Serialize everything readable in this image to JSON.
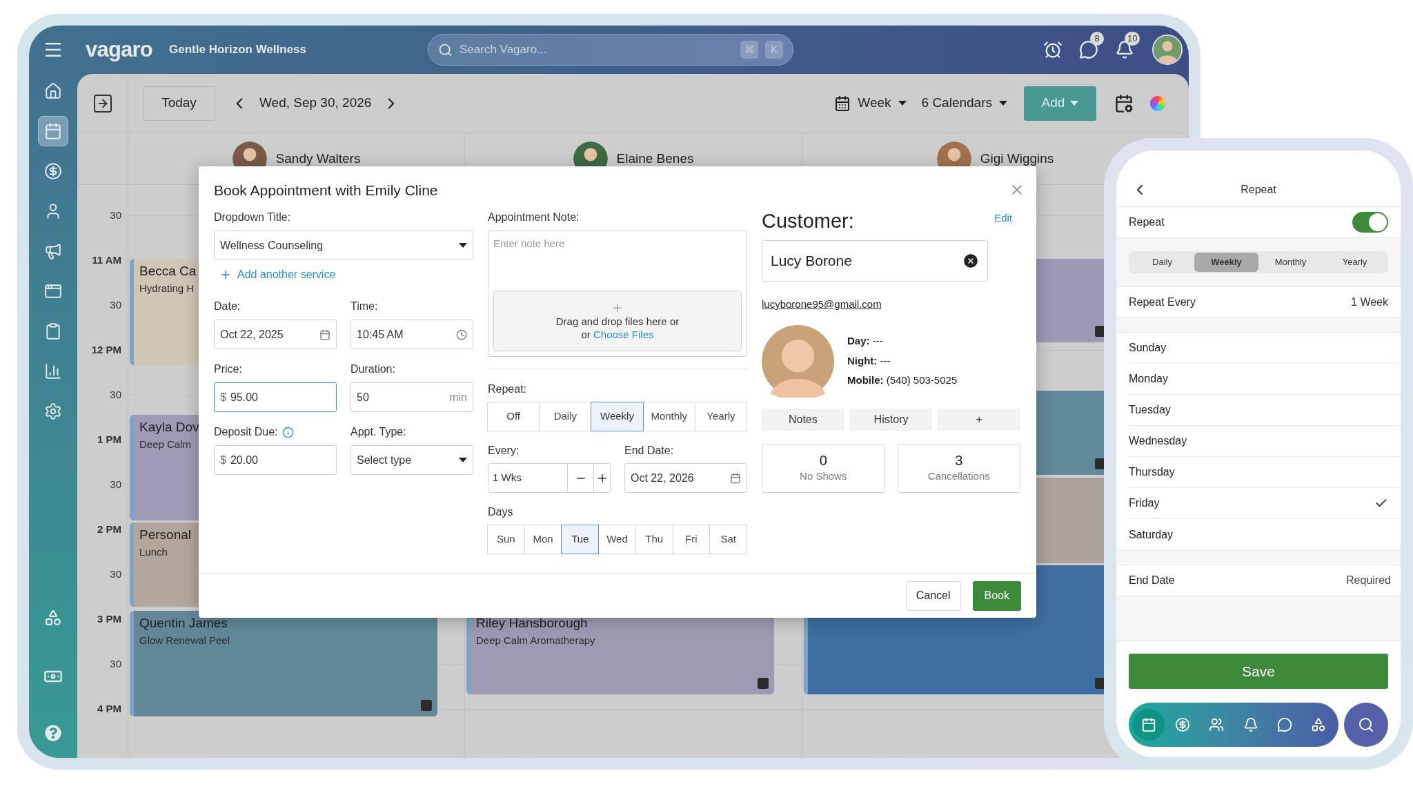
{
  "header": {
    "brand": "vagaro",
    "business_name": "Gentle Horizon Wellness",
    "search": {
      "placeholder": "Search Vagaro...",
      "shortcut": [
        "⌘",
        "K"
      ]
    },
    "messages_badge": "8",
    "notifications_badge": "10"
  },
  "sidebar": {
    "items": [
      {
        "selected": false
      },
      {
        "selected": true
      },
      {
        "selected": false
      },
      {
        "selected": false
      },
      {
        "selected": false
      },
      {
        "selected": false
      },
      {
        "selected": false
      },
      {
        "selected": false
      },
      {
        "selected": false
      }
    ]
  },
  "toolbar": {
    "today": "Today",
    "date": "Wed, Sep 30, 2026",
    "view": "Week",
    "calendars": "6 Calendars",
    "add": "Add"
  },
  "calendar": {
    "time_labels": [
      "30",
      "11 AM",
      "30",
      "12 PM",
      "30",
      "1 PM",
      "30",
      "2 PM",
      "30",
      "3 PM",
      "30",
      "4 PM"
    ],
    "columns": [
      {
        "staff": "Sandy Walters",
        "events": [
          {
            "title": "Becca Ca",
            "service": "Hydrating H",
            "color": "#cfc6b6",
            "note": false
          },
          {
            "title": "Kayla Dov",
            "service": "Deep Calm",
            "color": "#9d9bb6",
            "note": false
          },
          {
            "title": "Personal",
            "service": "Lunch",
            "color": "#b3a79d",
            "note": false
          },
          {
            "title": "Quentin James",
            "service": "Glow Renewal Peel",
            "color": "#628898",
            "note": true
          }
        ]
      },
      {
        "staff": "Elaine Benes",
        "events": [
          {
            "title": "Riley Hansborough",
            "service": "Deep Calm Aromatherapy",
            "color": "#9e9ab3",
            "note": true
          }
        ]
      },
      {
        "staff": "Gigi Wiggins",
        "events": [
          {
            "color": "#9b99b5",
            "note": true
          },
          {
            "color": "#618a9c",
            "note": true
          },
          {
            "color": "#aaa39d",
            "note": false
          },
          {
            "color": "#3e6fa0",
            "note": true
          }
        ]
      }
    ]
  },
  "modal": {
    "title": "Book Appointment with Emily Cline",
    "service_label": "Dropdown Title:",
    "service": "Wellness Counseling",
    "add_service": "Add another service",
    "date_label": "Date:",
    "date": "Oct 22, 2025",
    "time_label": "Time:",
    "time": "10:45 AM",
    "price_label": "Price:",
    "price": {
      "prefix": "$",
      "value": "95.00",
      "focused": true
    },
    "duration_label": "Duration:",
    "duration": {
      "value": "50",
      "unit": "min"
    },
    "deposit_label": "Deposit Due:",
    "deposit": {
      "prefix": "$",
      "value": "20.00"
    },
    "type_label": "Appt. Type:",
    "appt_type": {
      "placeholder": "Select type"
    },
    "note_label": "Appointment Note:",
    "note": {
      "placeholder": "Enter note here"
    },
    "dropzone": {
      "line1": "Drag and drop files here or",
      "line2": "or",
      "link": "Choose Files"
    },
    "repeat_label": "Repeat:",
    "repeat_options": [
      {
        "label": "Off",
        "selected": false
      },
      {
        "label": "Daily",
        "selected": false
      },
      {
        "label": "Weekly",
        "selected": true
      },
      {
        "label": "Monthly",
        "selected": false
      },
      {
        "label": "Yearly",
        "selected": false
      }
    ],
    "every_label": "Every:",
    "every": "1 Wks",
    "end_date_label": "End Date:",
    "end_date": "Oct 22, 2026",
    "days_label": "Days",
    "days": [
      {
        "label": "Sun",
        "selected": false
      },
      {
        "label": "Mon",
        "selected": false
      },
      {
        "label": "Tue",
        "selected": true
      },
      {
        "label": "Wed",
        "selected": false
      },
      {
        "label": "Thu",
        "selected": false
      },
      {
        "label": "Fri",
        "selected": false
      },
      {
        "label": "Sat",
        "selected": false
      }
    ],
    "customer": {
      "heading": "Customer:",
      "edit": "Edit",
      "name": "Lucy Borone",
      "email": "lucyborone95@gmail.com",
      "contact": [
        "**Day:** ---",
        "**Night:** ---",
        "**Mobile:** (540) 503-5025"
      ],
      "tabs": [
        "Notes",
        "History",
        "+"
      ],
      "stats": [
        {
          "value": "0",
          "label": "No Shows"
        },
        {
          "value": "3",
          "label": "Cancellations"
        }
      ]
    },
    "cancel": "Cancel",
    "book": "Book"
  },
  "phone": {
    "title": "Repeat",
    "repeat_label": "Repeat",
    "repeat_on": true,
    "frequencies": [
      {
        "label": "Daily",
        "selected": false
      },
      {
        "label": "Weekly",
        "selected": true
      },
      {
        "label": "Monthly",
        "selected": false
      },
      {
        "label": "Yearly",
        "selected": false
      }
    ],
    "repeat_every_label": "Repeat Every",
    "repeat_every": "1 Week",
    "days": [
      {
        "label": "Sunday",
        "checked": false
      },
      {
        "label": "Monday",
        "checked": false
      },
      {
        "label": "Tuesday",
        "checked": false
      },
      {
        "label": "Wednesday",
        "checked": false
      },
      {
        "label": "Thursday",
        "checked": false
      },
      {
        "label": "Friday",
        "checked": true
      },
      {
        "label": "Saturday",
        "checked": false
      }
    ],
    "end_date_label": "End Date",
    "end_date": "Required",
    "save": "Save",
    "nav": [
      {
        "selected": true
      },
      {
        "selected": false
      },
      {
        "selected": false
      },
      {
        "selected": false
      },
      {
        "selected": false
      },
      {
        "selected": false
      }
    ]
  }
}
